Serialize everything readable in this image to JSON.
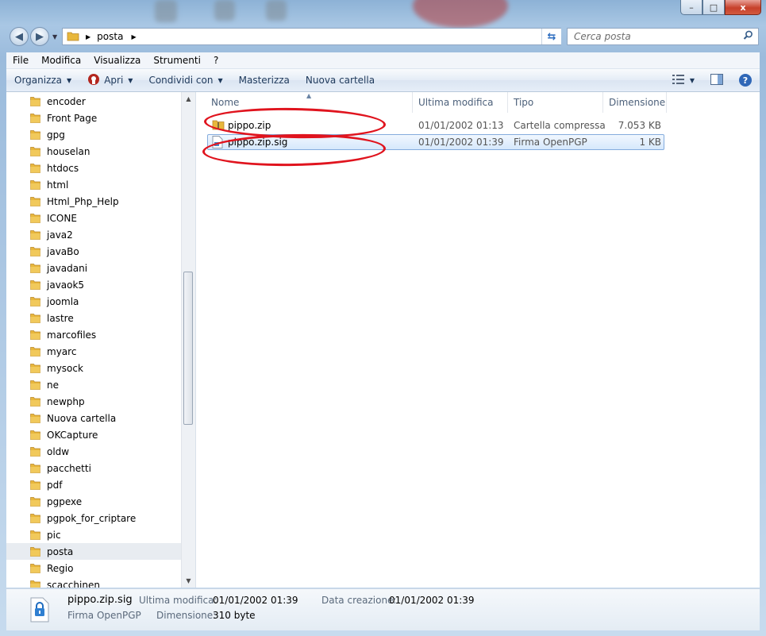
{
  "window": {
    "caption_buttons": {
      "minimize": "–",
      "maximize": "□",
      "close": "x"
    }
  },
  "address": {
    "crumbs": [
      "posta"
    ],
    "dropdown_icon": "chevron-down-icon",
    "refresh_icon": "refresh-icon"
  },
  "search": {
    "placeholder": "Cerca posta"
  },
  "menu": {
    "items": [
      "File",
      "Modifica",
      "Visualizza",
      "Strumenti",
      "?"
    ]
  },
  "toolbar": {
    "organize": "Organizza",
    "open": "Apri",
    "share": "Condividi con",
    "burn": "Masterizza",
    "new_folder": "Nuova cartella"
  },
  "nav_tree": {
    "items": [
      "encoder",
      "Front Page",
      "gpg",
      "houselan",
      "htdocs",
      "html",
      "Html_Php_Help",
      "ICONE",
      "java2",
      "javaBo",
      "javadani",
      "javaok5",
      "joomla",
      "lastre",
      "marcofiles",
      "myarc",
      "mysock",
      "ne",
      "newphp",
      "Nuova cartella",
      "OKCapture",
      "oldw",
      "pacchetti",
      "pdf",
      "pgpexe",
      "pgpok_for_criptare",
      "pic",
      "posta",
      "Regio",
      "scacchinen"
    ],
    "selected": "posta"
  },
  "columns": {
    "name": "Nome",
    "modified": "Ultima modifica",
    "type": "Tipo",
    "size": "Dimensione"
  },
  "files": [
    {
      "name": "pippo.zip",
      "modified": "01/01/2002 01:13",
      "type": "Cartella compressa",
      "size": "7.053 KB",
      "icon": "zip-folder-icon"
    },
    {
      "name": "pippo.zip.sig",
      "modified": "01/01/2002 01:39",
      "type": "Firma OpenPGP",
      "size": "1 KB",
      "icon": "signature-file-icon"
    }
  ],
  "details": {
    "filename": "pippo.zip.sig",
    "filetype": "Firma OpenPGP",
    "modified_label": "Ultima modifica:",
    "modified_value": "01/01/2002 01:39",
    "created_label": "Data creazione:",
    "created_value": "01/01/2002 01:39",
    "size_label": "Dimensione:",
    "size_value": "310 byte",
    "icon": "lock-file-icon"
  },
  "colors": {
    "annotation": "#e0141e",
    "selection": "#d6e8fc",
    "folder": "#e8b73c"
  }
}
